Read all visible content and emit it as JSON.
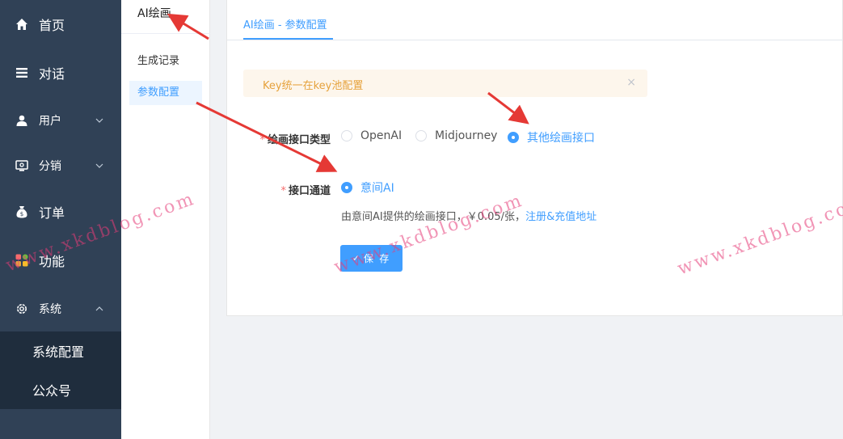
{
  "sidebar": {
    "items": [
      {
        "label": "首页",
        "icon": "home-icon"
      },
      {
        "label": "对话",
        "icon": "list-icon"
      },
      {
        "label": "用户",
        "icon": "user-icon"
      },
      {
        "label": "分销",
        "icon": "distribution-icon"
      },
      {
        "label": "订单",
        "icon": "money-bag-icon"
      },
      {
        "label": "功能",
        "icon": "apps-icon"
      },
      {
        "label": "系统",
        "icon": "gear-icon"
      }
    ],
    "sub_items": [
      {
        "label": "系统配置"
      },
      {
        "label": "公众号"
      }
    ]
  },
  "submenu": {
    "title": "AI绘画",
    "items": [
      {
        "label": "生成记录"
      },
      {
        "label": "参数配置"
      }
    ]
  },
  "main": {
    "tab_label": "AI绘画 - 参数配置",
    "alert_text": "Key统一在key池配置",
    "alert_close": "×",
    "draw_type": {
      "label": "绘画接口类型",
      "options": [
        "OpenAI",
        "Midjourney",
        "其他绘画接口"
      ],
      "selected": "其他绘画接口"
    },
    "channel": {
      "label": "接口通道",
      "options": [
        "意间AI"
      ],
      "selected": "意间AI"
    },
    "hint_text": "由意间AI提供的绘画接口，￥0.05/张，",
    "hint_link": "注册&充值地址",
    "save_label": "保 存"
  },
  "watermark": "www.xkdblog.com",
  "colors": {
    "sidebar_bg": "#304156",
    "sidebar_active_bg": "#1f2d3d",
    "primary": "#409eff",
    "warning": "#e6a23c",
    "required": "#f56c6c",
    "arrow": "#e53935"
  }
}
